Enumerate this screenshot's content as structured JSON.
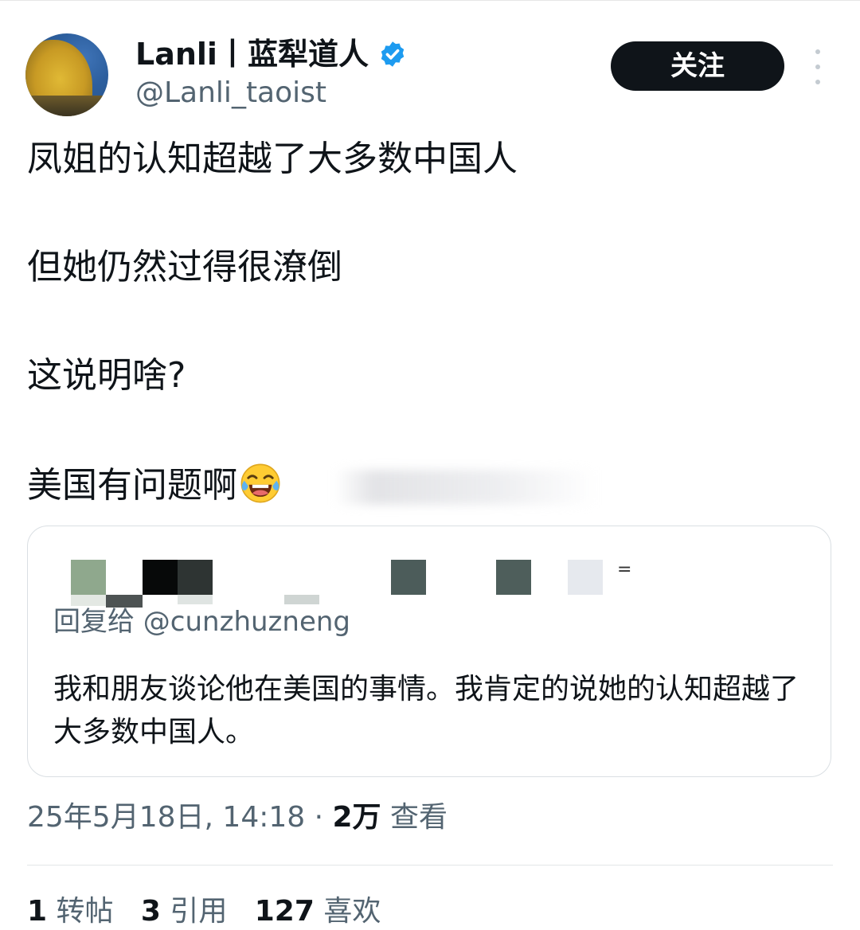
{
  "tweet": {
    "author": {
      "display_name": "Lanli丨蓝犁道人",
      "handle": "@Lanli_taoist",
      "verified": true,
      "verified_color": "#1d9bf0"
    },
    "follow_label": "关注",
    "lines": [
      "凤姐的认知超越了大多数中国人",
      "但她仍然过得很潦倒",
      "这说明啥?",
      "美国有问题啊"
    ],
    "emoji": "face-with-tears-of-joy-icon",
    "quote": {
      "reply_to": "回复给 @cunzhuzneng",
      "text": "我和朋友谈论他在美国的事情。我肯定的说她的认知超越了大多数中国人。"
    },
    "meta": {
      "timestamp": "25年5月18日, 14:18",
      "separator": " · ",
      "views_count": "2万",
      "views_label": " 查看"
    },
    "stats": [
      {
        "count": "1",
        "label": " 转帖"
      },
      {
        "count": "3",
        "label": " 引用"
      },
      {
        "count": "127",
        "label": " 喜欢"
      }
    ]
  }
}
